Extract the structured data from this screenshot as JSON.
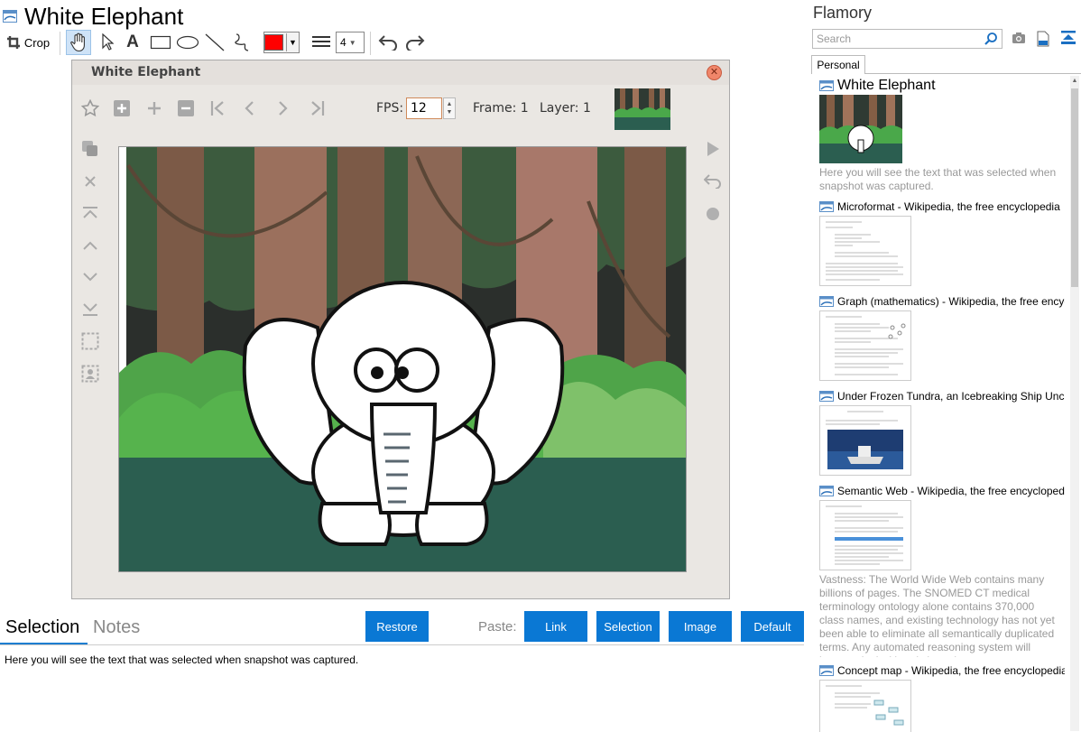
{
  "window": {
    "title": "White Elephant"
  },
  "toolbar": {
    "crop_label": "Crop",
    "width_value": "4",
    "color": "#ff0000",
    "tools": [
      "crop-icon",
      "hand-icon",
      "pointer-icon",
      "text-icon",
      "rectangle-icon",
      "ellipse-icon",
      "line-icon",
      "freehand-icon",
      "line-width-icon",
      "undo-icon",
      "redo-icon"
    ]
  },
  "animator": {
    "title": "White Elephant",
    "fps_label": "FPS:",
    "fps_value": "12",
    "frame_label": "Frame: 1",
    "layer_label": "Layer: 1",
    "controls": [
      "star-icon",
      "add-frame-icon",
      "plus-icon",
      "minus-icon",
      "first-frame-icon",
      "prev-frame-icon",
      "next-frame-icon",
      "last-frame-icon"
    ],
    "side_tools": [
      "duplicate-icon",
      "delete-icon",
      "move-top-icon",
      "move-up-icon",
      "move-down-icon",
      "move-bottom-icon",
      "select-area-icon",
      "select-character-icon"
    ],
    "right_tools": [
      "play-icon",
      "return-icon",
      "record-icon"
    ]
  },
  "bottom": {
    "tabs": [
      {
        "label": "Selection",
        "active": true
      },
      {
        "label": "Notes",
        "active": false
      }
    ],
    "restore_label": "Restore",
    "paste_label": "Paste:",
    "paste_buttons": [
      "Link",
      "Selection",
      "Image",
      "Default"
    ],
    "selection_text": "Here you will see the text that was selected when snapshot was captured."
  },
  "sidebar": {
    "title": "Flamory",
    "search_placeholder": "Search",
    "tab": "Personal",
    "accent": "#0a78d4",
    "items": [
      {
        "title": "White Elephant",
        "desc": "Here you will see the text that was selected when snapshot was captured."
      },
      {
        "title": "Microformat - Wikipedia, the free encyclopedia"
      },
      {
        "title": "Graph (mathematics) - Wikipedia, the free encyclopedia"
      },
      {
        "title": "Under Frozen Tundra, an Icebreaking Ship Uncovers History"
      },
      {
        "title": "Semantic Web - Wikipedia, the free encyclopedia",
        "desc": "Vastness: The World Wide Web contains many billions of pages. The SNOMED CT medical terminology ontology alone contains 370,000 class names, and existing technology has not yet been able to eliminate all semantically duplicated terms. Any automated reasoning system will have to deal with truly huge inputs."
      },
      {
        "title": "Concept map - Wikipedia, the free encyclopedia"
      }
    ]
  }
}
